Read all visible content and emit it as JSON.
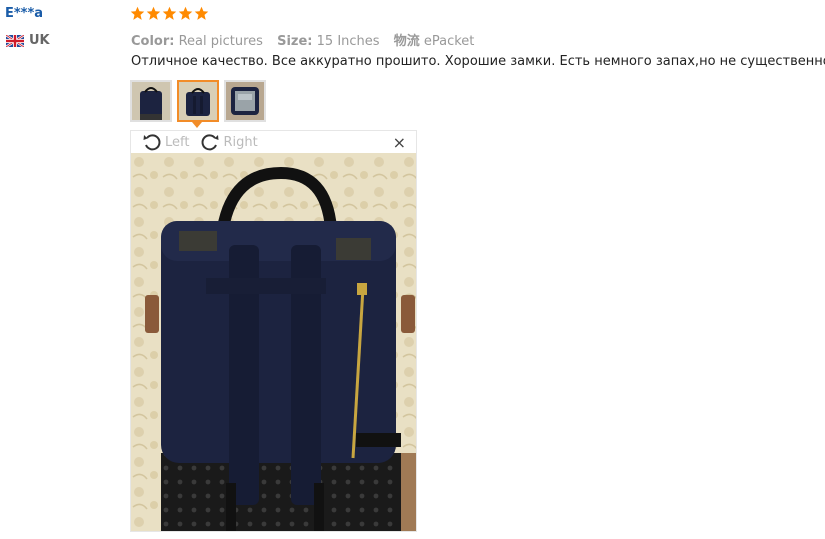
{
  "review": {
    "username": "E***a",
    "country": "UK",
    "rating": 5,
    "color_label": "Color:",
    "color_value": "Real pictures",
    "size_label": "Size:",
    "size_value": "15 Inches",
    "shipping_label": "物流",
    "shipping_value": "ePacket",
    "comment": "Отличное качество. Все аккуратно прошито. Хорошие замки. Есть немного запах,но не существенно"
  },
  "viewer": {
    "rotate_left_label": "Left",
    "rotate_right_label": "Right",
    "close_label": "×"
  },
  "colors": {
    "star": "#ff8a00",
    "name": "#1a5ca8",
    "active_thumb": "#f28c28",
    "backpack": "#1c2340"
  }
}
